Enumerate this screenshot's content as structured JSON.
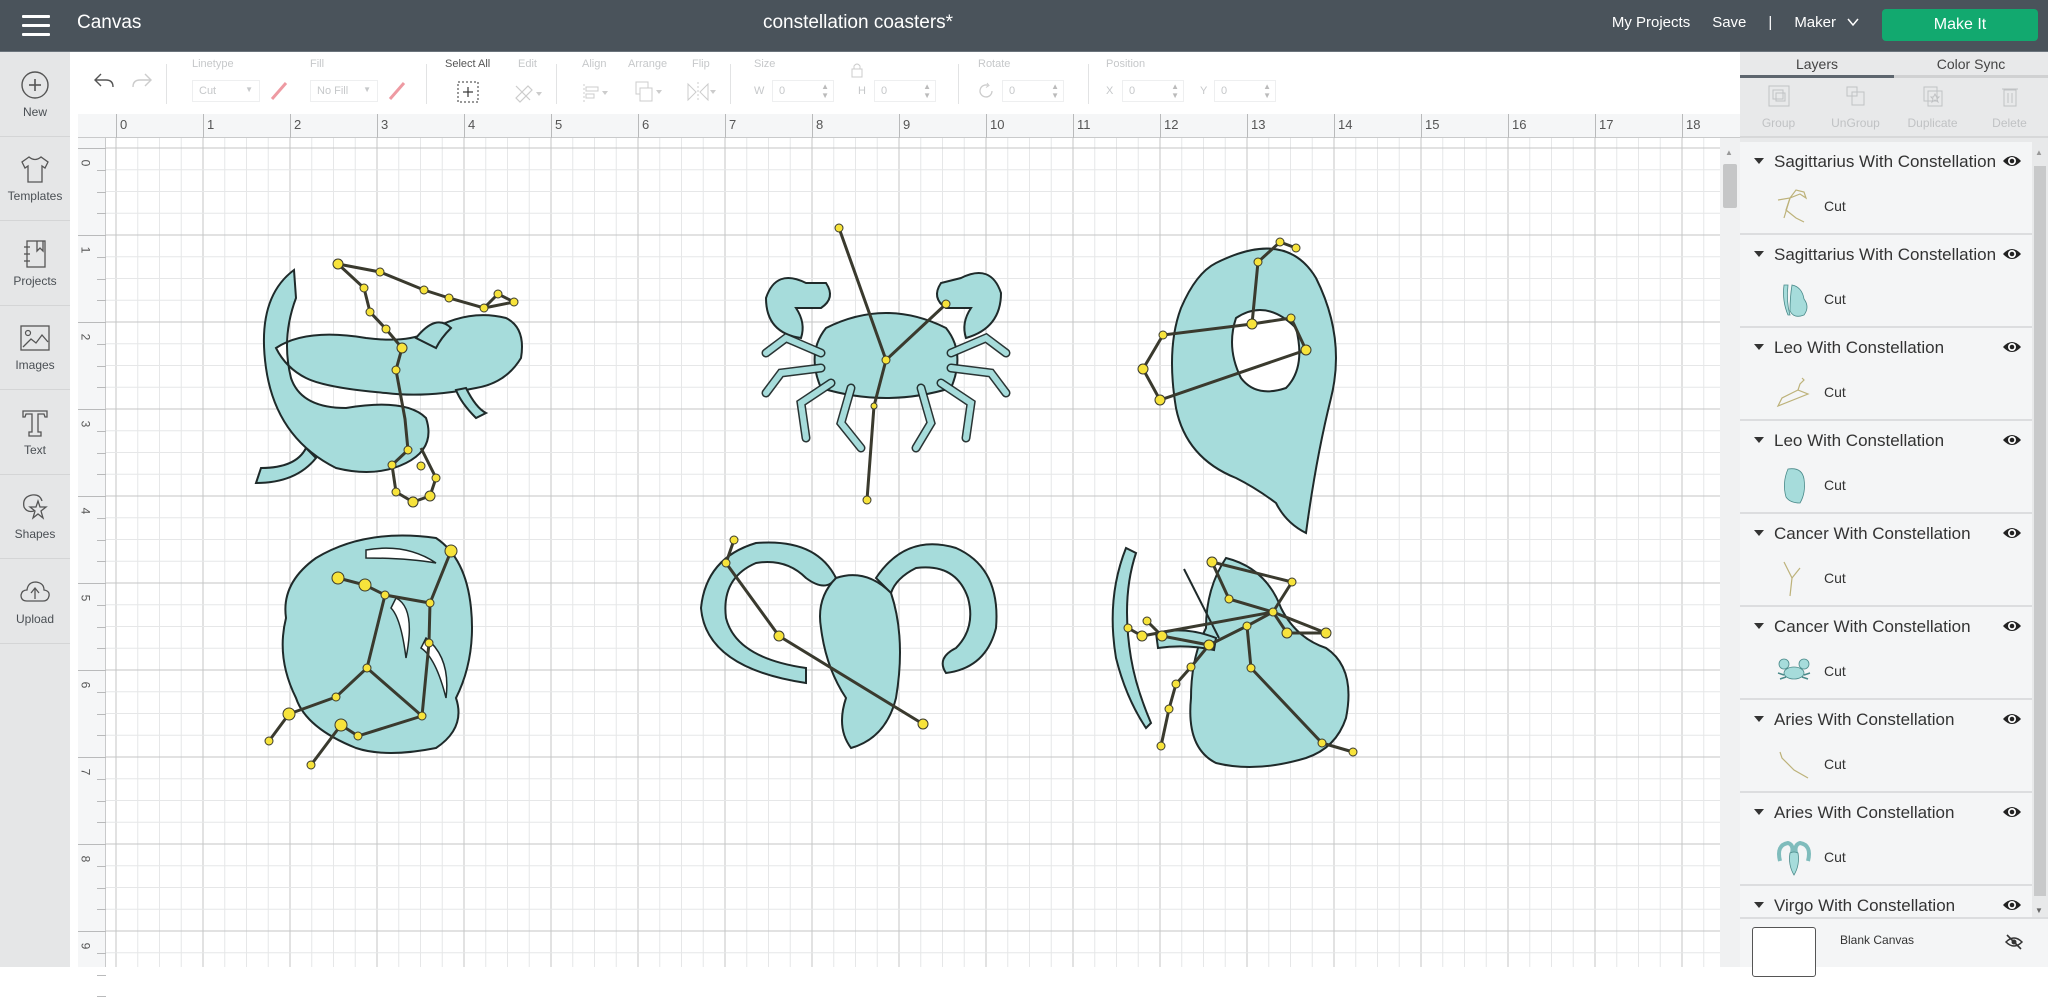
{
  "header": {
    "app_title": "Canvas",
    "doc_title": "constellation coasters*",
    "links": [
      "My Projects",
      "Save"
    ],
    "separator": "|",
    "machine": "Maker",
    "make_it": "Make It",
    "accent_color": "#12a96f",
    "bar_color": "#4a535b"
  },
  "sidebar": {
    "items": [
      {
        "label": "New",
        "icon": "plus-circle-icon"
      },
      {
        "label": "Templates",
        "icon": "tshirt-icon"
      },
      {
        "label": "Projects",
        "icon": "notebook-icon"
      },
      {
        "label": "Images",
        "icon": "image-icon"
      },
      {
        "label": "Text",
        "icon": "text-t-icon"
      },
      {
        "label": "Shapes",
        "icon": "shapes-icon"
      },
      {
        "label": "Upload",
        "icon": "cloud-upload-icon"
      }
    ]
  },
  "toolbar": {
    "linetype_label": "Linetype",
    "linetype_value": "Cut",
    "fill_label": "Fill",
    "fill_value": "No Fill",
    "select_all": "Select All",
    "edit": "Edit",
    "align": "Align",
    "arrange": "Arrange",
    "flip": "Flip",
    "size": "Size",
    "w_label": "W",
    "w_value": "0",
    "h_label": "H",
    "h_value": "0",
    "rotate": "Rotate",
    "rotate_value": "0",
    "position": "Position",
    "x_label": "X",
    "x_value": "0",
    "y_label": "Y",
    "y_value": "0"
  },
  "rulers": {
    "horizontal": [
      "0",
      "1",
      "2",
      "3",
      "4",
      "5",
      "6",
      "7",
      "8",
      "9",
      "10",
      "11",
      "12",
      "13",
      "14",
      "15",
      "16",
      "17",
      "18"
    ],
    "vertical": [
      "0",
      "1",
      "2",
      "3",
      "4",
      "5",
      "6",
      "7",
      "8",
      "9"
    ]
  },
  "canvas": {
    "designs": [
      {
        "name": "Pisces fish with constellation"
      },
      {
        "name": "Cancer crab with constellation"
      },
      {
        "name": "Leo lion with constellation"
      },
      {
        "name": "Virgo with constellation"
      },
      {
        "name": "Aries ram with constellation"
      },
      {
        "name": "Sagittarius archer with constellation"
      }
    ],
    "fill_color": "#a6dcdb",
    "star_color": "#f7e33b",
    "line_color": "#3a3a2e"
  },
  "panel": {
    "tabs": [
      "Layers",
      "Color Sync"
    ],
    "actions": [
      "Group",
      "UnGroup",
      "Duplicate",
      "Delete"
    ],
    "layers": [
      {
        "name": "Sagittarius With Constellation",
        "sub": "Cut",
        "thumb": "constellation"
      },
      {
        "name": "Sagittarius With Constellation",
        "sub": "Cut",
        "thumb": "art"
      },
      {
        "name": "Leo With Constellation",
        "sub": "Cut",
        "thumb": "constellation"
      },
      {
        "name": "Leo With Constellation",
        "sub": "Cut",
        "thumb": "art"
      },
      {
        "name": "Cancer With Constellation",
        "sub": "Cut",
        "thumb": "constellation"
      },
      {
        "name": "Cancer With Constellation",
        "sub": "Cut",
        "thumb": "art"
      },
      {
        "name": "Aries With Constellation",
        "sub": "Cut",
        "thumb": "constellation"
      },
      {
        "name": "Aries With Constellation",
        "sub": "Cut",
        "thumb": "art"
      },
      {
        "name": "Virgo With Constellation",
        "sub": "",
        "thumb": ""
      }
    ],
    "blank_canvas": "Blank Canvas"
  }
}
